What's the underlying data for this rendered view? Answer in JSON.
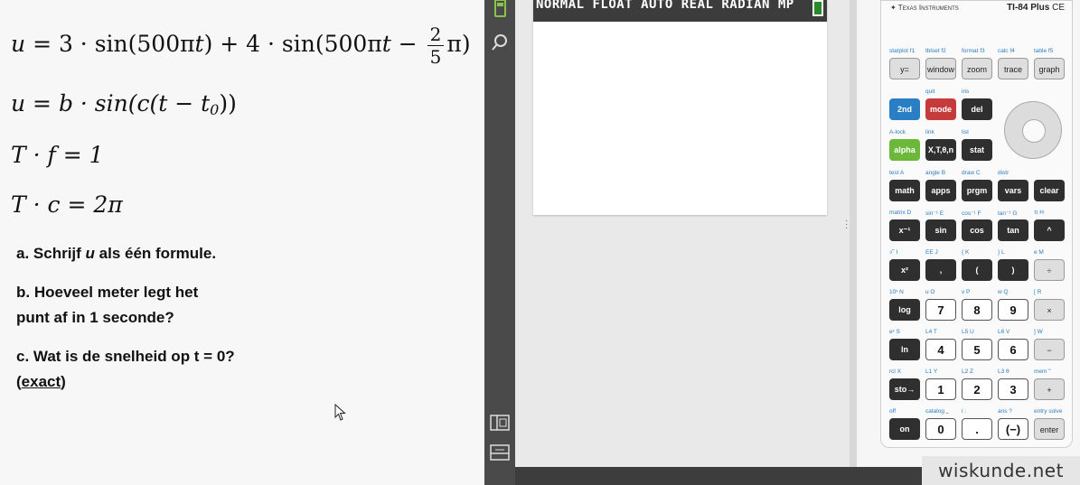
{
  "document": {
    "formulas": {
      "f1": {
        "lhs": "u",
        "expr_a": "= 3 · sin(500π",
        "t": "t",
        "expr_b": ") + 4 · sin(500π",
        "expr_c": " −",
        "frac_num": "2",
        "frac_den": "5",
        "expr_d": "π)"
      },
      "f2": {
        "text_a": "u = b · sin(c(t − t",
        "sub": "0",
        "text_b": "))"
      },
      "f3": {
        "text": "T · f = 1"
      },
      "f4": {
        "text": "T · c = 2π"
      }
    },
    "questions": {
      "a_prefix": "a. Schrijf ",
      "a_var": "u",
      "a_suffix": " als één formule.",
      "b_line1": "b. Hoeveel meter legt het",
      "b_line2": "punt af in 1 seconde?",
      "c_line1": "c. Wat is de snelheid op t = 0?",
      "c_paren_open": "(",
      "c_exact": "exact",
      "c_paren_close": ")"
    }
  },
  "calculator": {
    "status_text": "NORMAL FLOAT AUTO REAL RADIAN MP",
    "brand": "Texas Instruments",
    "model": "TI-84 Plus",
    "model_suffix": " CE",
    "rows": [
      {
        "labels": [
          "statplot f1",
          "tblset f2",
          "format f3",
          "calc f4",
          "table f5"
        ],
        "keys": [
          "y=",
          "window",
          "zoom",
          "trace",
          "graph"
        ]
      },
      {
        "labels": [
          "",
          "quit",
          "ins"
        ],
        "keys": [
          "2nd",
          "mode",
          "del"
        ]
      },
      {
        "labels": [
          "A-lock",
          "link",
          "list"
        ],
        "keys": [
          "alpha",
          "X,T,θ,n",
          "stat"
        ]
      },
      {
        "labels": [
          "test  A",
          "angle  B",
          "draw  C",
          "distr",
          ""
        ],
        "keys": [
          "math",
          "apps",
          "prgm",
          "vars",
          "clear"
        ]
      },
      {
        "labels": [
          "matrix  D",
          "sin⁻¹  E",
          "cos⁻¹  F",
          "tan⁻¹  G",
          "π  H"
        ],
        "keys": [
          "x⁻¹",
          "sin",
          "cos",
          "tan",
          "^"
        ]
      },
      {
        "labels": [
          "√‾  I",
          "EE  J",
          "{  K",
          "}  L",
          "e  M"
        ],
        "keys": [
          "x²",
          ",",
          "(",
          ")",
          "÷"
        ]
      },
      {
        "labels": [
          "10ˣ  N",
          "u  O",
          "v  P",
          "w  Q",
          "[  R"
        ],
        "keys": [
          "log",
          "7",
          "8",
          "9",
          "×"
        ]
      },
      {
        "labels": [
          "eˣ  S",
          "L4  T",
          "L5  U",
          "L6  V",
          "]  W"
        ],
        "keys": [
          "ln",
          "4",
          "5",
          "6",
          "−"
        ]
      },
      {
        "labels": [
          "rcl  X",
          "L1  Y",
          "L2  Z",
          "L3  θ",
          "mem  \""
        ],
        "keys": [
          "sto→",
          "1",
          "2",
          "3",
          "+"
        ]
      },
      {
        "labels": [
          "off",
          "catalog  ⎵",
          "i  :",
          "ans  ?",
          "entry solve"
        ],
        "keys": [
          "on",
          "0",
          ".",
          "(−)",
          "enter"
        ]
      }
    ]
  },
  "watermark": "wiskunde.net",
  "icons": [
    "calculator-icon",
    "search-icon",
    "layout-icon",
    "panel-icon",
    "battery-icon",
    "cursor-icon"
  ]
}
